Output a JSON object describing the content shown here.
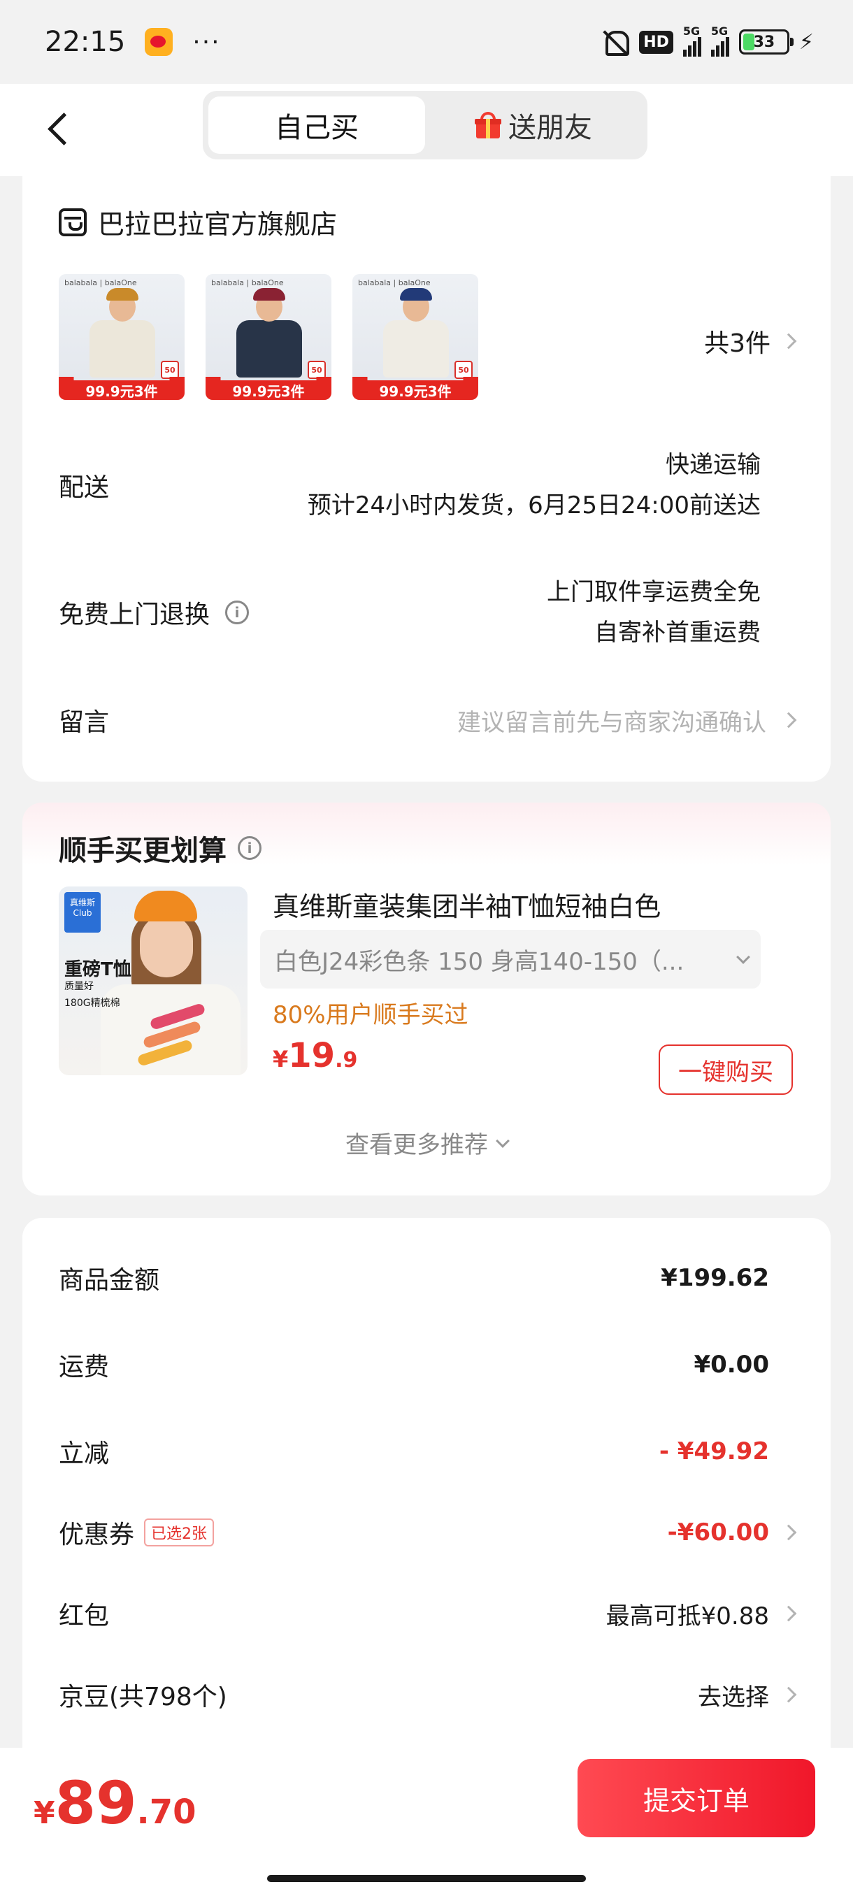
{
  "status_bar": {
    "time": "22:15",
    "dots": "···",
    "network_badge": "HD",
    "signal_tag_1": "5G",
    "signal_tag_2": "5G",
    "battery": "33",
    "battery_level": 0.33,
    "icons": [
      "weibo-icon",
      "bell-off-icon",
      "signal-icon",
      "battery-icon",
      "charging-icon"
    ]
  },
  "header": {
    "tabs": [
      {
        "label": "自己买",
        "active": true
      },
      {
        "label": "送朋友",
        "active": false,
        "icon": "gift-icon"
      }
    ]
  },
  "store": {
    "name": "巴拉巴拉官方旗舰店",
    "products": [
      {
        "brand": "balabala | balaOne",
        "price_tag": "99.9元3件",
        "badge": "50",
        "shirt_color": "#ece7da",
        "cap_color": "#c98a2a"
      },
      {
        "brand": "balabala | balaOne",
        "price_tag": "99.9元3件",
        "badge": "50",
        "shirt_color": "#283448",
        "cap_color": "#8a2233"
      },
      {
        "brand": "balabala | balaOne",
        "price_tag": "99.9元3件",
        "badge": "50",
        "shirt_color": "#efece4",
        "cap_color": "#223a78"
      }
    ],
    "count": "共3件"
  },
  "delivery": {
    "label": "配送",
    "method": "快递运输",
    "estimate": "预计24小时内发货，6月25日24:00前送达"
  },
  "returns": {
    "label": "免费上门退换",
    "line1": "上门取件享运费全免",
    "line2": "自寄补首重运费"
  },
  "remark": {
    "label": "留言",
    "placeholder": "建议留言前先与商家沟通确认"
  },
  "recommend": {
    "title": "顺手买更划算",
    "product_name": "真维斯童装集团半袖T恤短袖白色",
    "spec": "白色J24彩色条   150 身高140-150（...",
    "hint": "80%用户顺手买过",
    "price_symbol": "¥",
    "price_int": "19",
    "price_dec": ".9",
    "buy_label": "一键购买",
    "more_label": "查看更多推荐",
    "image_title": "重磅T恤",
    "image_sub1": "质量好",
    "image_sub2": "180G精梳棉",
    "image_logo": "真维斯 Club"
  },
  "price_summary": {
    "rows": [
      {
        "label": "商品金额",
        "value": "¥199.62"
      },
      {
        "label": "运费",
        "value": "¥0.00"
      },
      {
        "label": "立减",
        "value": "- ¥49.92"
      },
      {
        "label": "优惠券",
        "badge": "已选2张",
        "value": "-¥60.00"
      },
      {
        "label": "红包",
        "value": "最高可抵¥0.88"
      },
      {
        "label": "京豆(共798个)",
        "value": "去选择"
      }
    ]
  },
  "footer": {
    "total_symbol": "¥",
    "total_int": "89",
    "total_dec": ".70",
    "submit_label": "提交订单"
  },
  "colors": {
    "accent_red": "#e5322d",
    "hint_orange": "#d97a1e",
    "page_bg": "#f2f2f2"
  }
}
